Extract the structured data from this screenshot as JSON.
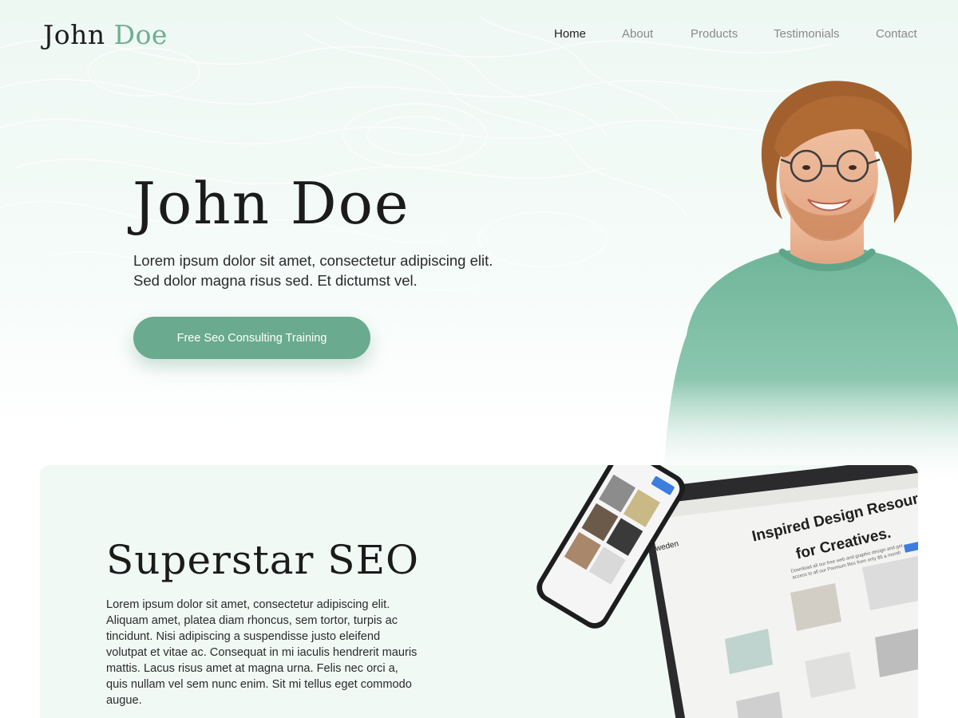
{
  "nav": {
    "logo_main": "John",
    "logo_accent": "Doe",
    "links": [
      "Home",
      "About",
      "Products",
      "Testimonials",
      "Contact"
    ],
    "active": "Home"
  },
  "hero": {
    "title": "John Doe",
    "subtitle": "Lorem ipsum dolor sit amet, consectetur adipiscing elit. Sed dolor magna risus sed. Et dictumst vel.",
    "cta_label": "Free Seo Consulting Training"
  },
  "feature": {
    "title": "Superstar SEO",
    "body": "Lorem ipsum dolor sit amet, consectetur adipiscing elit. Aliquam amet, platea diam rhoncus, sem tortor, turpis ac tincidunt. Nisi adipiscing a suspendisse justo eleifend volutpat et vitae ac. Consequat in mi iaculis hendrerit mauris mattis. Lacus risus amet at magna urna. Felis nec orci a, quis nullam vel sem nunc enim. Sit mi tellus eget commodo augue."
  },
  "mockup": {
    "headline_line1": "Inspired Design Resources",
    "headline_line2": "for Creatives.",
    "subtext": "Download all our free web and graphic design and get access to all our Premium files from only $5 a month",
    "brand": "weden"
  },
  "colors": {
    "accent": "#6aaa8e",
    "logo_accent": "#6fae93",
    "sweater": "#6fb59a",
    "card_bg": "#f1f9f5"
  }
}
